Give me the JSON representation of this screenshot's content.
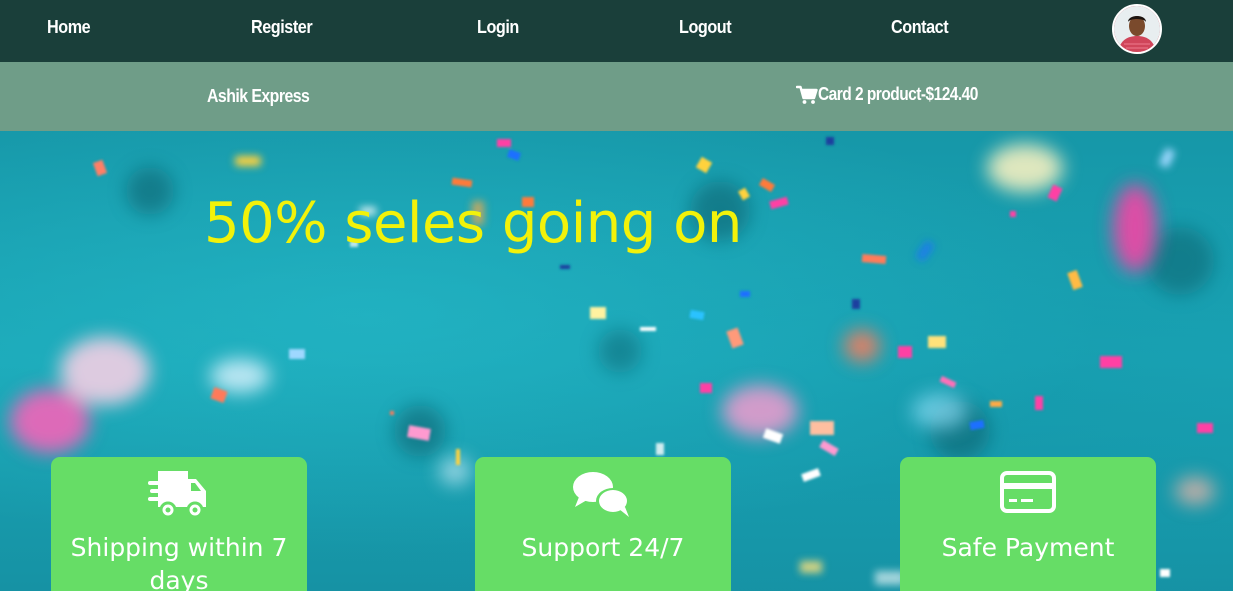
{
  "nav": {
    "items": [
      {
        "label": "Home"
      },
      {
        "label": "Register"
      },
      {
        "label": "Login"
      },
      {
        "label": "Logout"
      },
      {
        "label": "Contact"
      }
    ]
  },
  "subbar": {
    "brand": "Ashik Express",
    "cart_icon": "cart-icon",
    "cart_text": "Card 2 product-$124.40"
  },
  "hero": {
    "title": "50% seles going on"
  },
  "features": [
    {
      "icon": "truck-icon",
      "label": "Shipping within 7 days"
    },
    {
      "icon": "chat-icon",
      "label": "Support 24/7"
    },
    {
      "icon": "credit-card-icon",
      "label": "Safe Payment"
    }
  ],
  "colors": {
    "nav_bg": "#1a3f3a",
    "subbar_bg": "#6f9d88",
    "hero_bg": "#1aa3b3",
    "title": "#f2f20a",
    "card_bg": "#66dd66"
  }
}
